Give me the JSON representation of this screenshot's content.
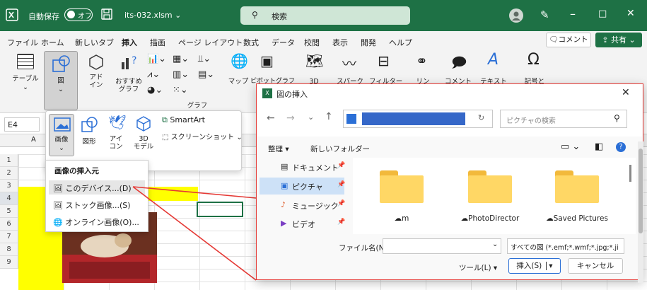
{
  "titlebar": {
    "autosave_label": "自動保存",
    "toggle_state": "オフ",
    "filename": "its-032.xlsm ⌄",
    "search_placeholder": "検索"
  },
  "menu": [
    "ファイル",
    "ホーム",
    "新しいタブ",
    "挿入",
    "描画",
    "ページ レイアウト",
    "数式",
    "データ",
    "校閲",
    "表示",
    "開発",
    "ヘルプ"
  ],
  "menu_right": {
    "comment": "コメント",
    "share": "共有"
  },
  "ribbon": {
    "table": "テーブル",
    "figure": "図",
    "addin": "アド\nイン",
    "recommended": "おすすめ\nグラフ",
    "map": "マップ",
    "pivot": "ピボットグラフ",
    "threed": "3D",
    "sparkline": "スパーク",
    "filter": "フィルター",
    "link": "リン",
    "comment": "コメント",
    "text": "テキスト",
    "symbol": "記号と",
    "group_graph": "グラフ"
  },
  "namebox": "E4",
  "rows": [
    "1",
    "2",
    "3",
    "4",
    "5",
    "6",
    "7",
    "8",
    "9"
  ],
  "col_a": "A",
  "dropdown": {
    "image": "画像",
    "shapes": "図形",
    "icons": "アイ\nコン",
    "models": "3D\nモデル",
    "smartart": "SmartArt",
    "screenshot": "スクリーンショット"
  },
  "submenu": {
    "header": "画像の挿入元",
    "items": [
      "このデバイス...(D)",
      "ストック画像...(S)",
      "オンライン画像(O)..."
    ]
  },
  "dialog": {
    "title": "図の挿入",
    "address_search": "ピクチャの検索",
    "organize": "整理 ▾",
    "new_folder": "新しいフォルダー",
    "nav": [
      "ドキュメント",
      "ピクチャ",
      "ミュージック",
      "ビデオ"
    ],
    "folders": [
      "m",
      "PhotoDirector",
      "Saved Pictures"
    ],
    "filename_label": "ファイル名(N):",
    "filetype": "すべての図 (*.emf;*.wmf;*.jpg;*.ji",
    "tools": "ツール(L)",
    "insert": "挿入(S)",
    "cancel": "キャンセル"
  },
  "colors": {
    "excel_green": "#1e7145",
    "highlight_yellow": "#ffff00",
    "dialog_border": "#e53935",
    "address_blue": "#3567c8"
  }
}
